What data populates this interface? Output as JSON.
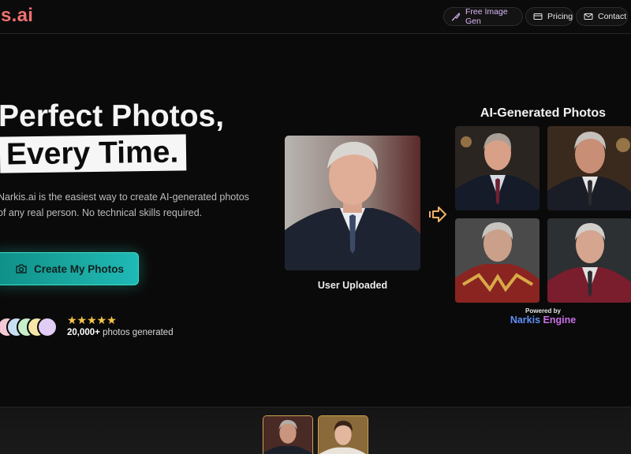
{
  "header": {
    "logo": "s.ai",
    "nav": [
      {
        "label": "Free Image Gen",
        "icon": "brush-icon"
      },
      {
        "label": "Pricing",
        "icon": "card-icon"
      },
      {
        "label": "Contact",
        "icon": "mail-icon"
      }
    ]
  },
  "hero": {
    "line1": "Perfect Photos,",
    "line2": "Every Time.",
    "description": "Narkis.ai is the easiest way to create AI-generated photos of any real person. No technical skills required.",
    "cta_label": "Create My Photos",
    "cta_icon": "camera-icon",
    "stars": "★★★★★",
    "count": "20,000+",
    "count_suffix": " photos generated"
  },
  "showcase": {
    "upload_label": "User Uploaded",
    "ai_title": "AI-Generated Photos",
    "powered_by": "Powered by",
    "engine_part1": "Narkis ",
    "engine_part2": "Engine"
  },
  "colors": {
    "brand": "#f07070",
    "cta": "#1aa8a0",
    "stars": "#f6c64a",
    "engine_blue": "#5f8ff6",
    "engine_purple": "#c770e6"
  }
}
